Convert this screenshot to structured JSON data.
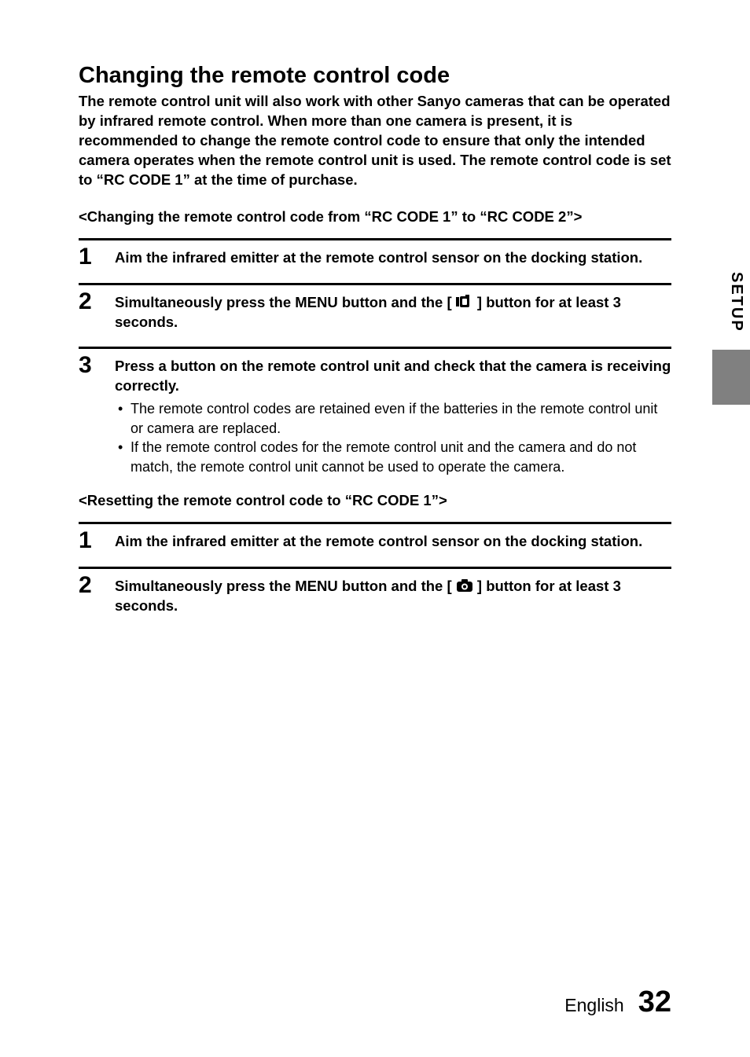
{
  "sideTab": "SETUP",
  "title": "Changing the remote control code",
  "intro": "The remote control unit will also work with other Sanyo cameras that can be operated by infrared remote control. When more than one camera is present, it is recommended to change the remote control code to ensure that only the intended camera operates when the remote control unit is used. The remote control code is set to “RC CODE 1” at the time of purchase.",
  "section1": {
    "heading": "<Changing the remote control code from “RC CODE 1” to “RC CODE 2”>",
    "steps": [
      {
        "num": "1",
        "title": "Aim the infrared emitter at the remote control sensor on the docking station."
      },
      {
        "num": "2",
        "titleBefore": "Simultaneously press the MENU button and the [ ",
        "titleAfter": " ] button for at least 3 seconds.",
        "icon": "video-icon"
      },
      {
        "num": "3",
        "title": "Press a button on the remote control unit and check that the camera is receiving correctly.",
        "bullets": [
          "The remote control codes are retained even if the batteries in the remote control unit or camera are replaced.",
          "If the remote control codes for the remote control unit and the camera and do not match, the remote control unit cannot be used to operate the camera."
        ]
      }
    ]
  },
  "section2": {
    "heading": "<Resetting the remote control code to “RC CODE 1”>",
    "steps": [
      {
        "num": "1",
        "title": "Aim the infrared emitter at the remote control sensor on the docking station."
      },
      {
        "num": "2",
        "titleBefore": "Simultaneously press the MENU button and the [ ",
        "titleAfter": " ] button for at least 3 seconds.",
        "icon": "camera-icon"
      }
    ]
  },
  "footer": {
    "lang": "English",
    "page": "32"
  }
}
